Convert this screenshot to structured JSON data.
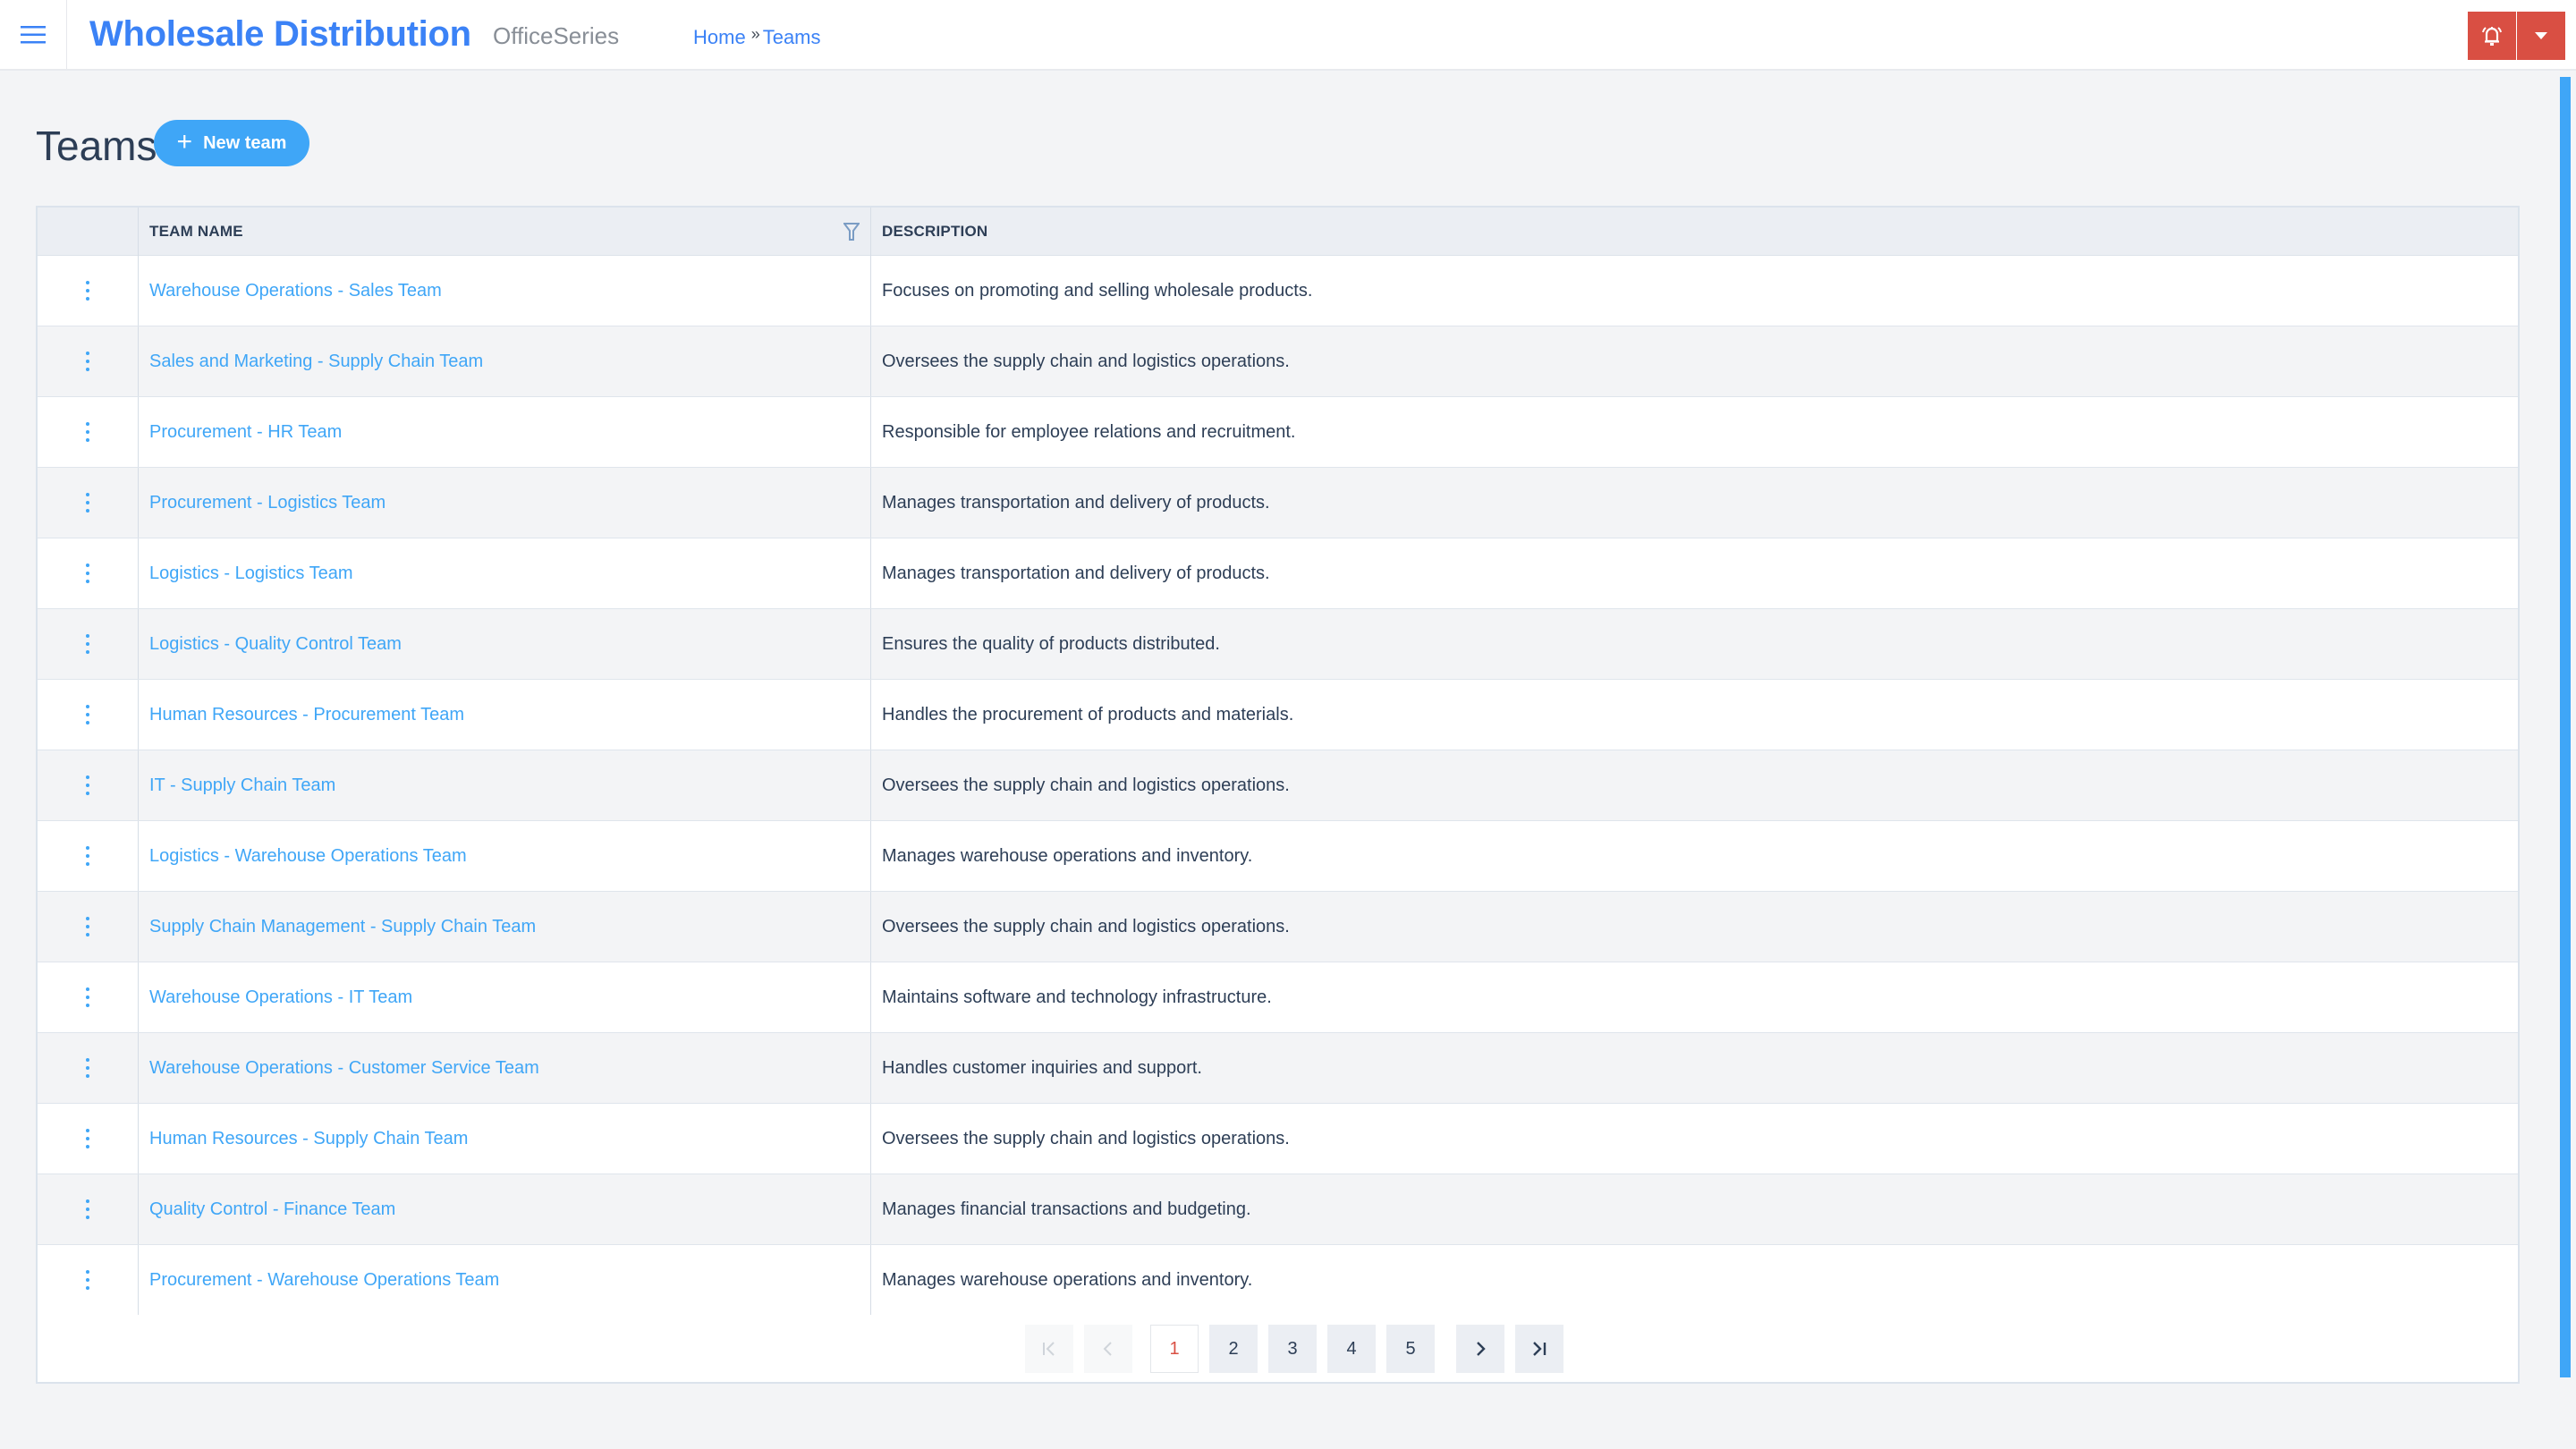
{
  "header": {
    "app_title": "Wholesale Distribution",
    "app_subtitle": "OfficeSeries",
    "breadcrumb": [
      {
        "label": "Home"
      },
      {
        "label": "Teams"
      }
    ],
    "breadcrumb_separator": "»",
    "menu_icon": "hamburger-icon",
    "notification_icon": "bell-icon",
    "dropdown_icon": "caret-down-icon",
    "accent_color": "#3b82f6",
    "alert_color": "#d94f43"
  },
  "page": {
    "title": "Teams",
    "new_button_label": "New team",
    "new_button_icon": "plus-icon"
  },
  "table": {
    "columns": [
      "",
      "TEAM NAME",
      "DESCRIPTION"
    ],
    "filter_icon": "filter-icon",
    "row_action_icon": "kebab-menu-icon",
    "rows": [
      {
        "name": "Warehouse Operations - Sales Team",
        "description": "Focuses on promoting and selling wholesale products."
      },
      {
        "name": "Sales and Marketing - Supply Chain Team",
        "description": "Oversees the supply chain and logistics operations."
      },
      {
        "name": "Procurement - HR Team",
        "description": "Responsible for employee relations and recruitment."
      },
      {
        "name": "Procurement - Logistics Team",
        "description": "Manages transportation and delivery of products."
      },
      {
        "name": "Logistics - Logistics Team",
        "description": "Manages transportation and delivery of products."
      },
      {
        "name": "Logistics - Quality Control Team",
        "description": "Ensures the quality of products distributed."
      },
      {
        "name": "Human Resources - Procurement Team",
        "description": "Handles the procurement of products and materials."
      },
      {
        "name": "IT - Supply Chain Team",
        "description": "Oversees the supply chain and logistics operations."
      },
      {
        "name": "Logistics - Warehouse Operations Team",
        "description": "Manages warehouse operations and inventory."
      },
      {
        "name": "Supply Chain Management - Supply Chain Team",
        "description": "Oversees the supply chain and logistics operations."
      },
      {
        "name": "Warehouse Operations - IT Team",
        "description": "Maintains software and technology infrastructure."
      },
      {
        "name": "Warehouse Operations - Customer Service Team",
        "description": "Handles customer inquiries and support."
      },
      {
        "name": "Human Resources - Supply Chain Team",
        "description": "Oversees the supply chain and logistics operations."
      },
      {
        "name": "Quality Control - Finance Team",
        "description": "Manages financial transactions and budgeting."
      },
      {
        "name": "Procurement - Warehouse Operations Team",
        "description": "Manages warehouse operations and inventory."
      }
    ]
  },
  "pagination": {
    "first_icon": "first-page-icon",
    "prev_icon": "prev-page-icon",
    "next_icon": "next-page-icon",
    "last_icon": "last-page-icon",
    "pages": [
      "1",
      "2",
      "3",
      "4",
      "5"
    ],
    "current_page": "1"
  }
}
